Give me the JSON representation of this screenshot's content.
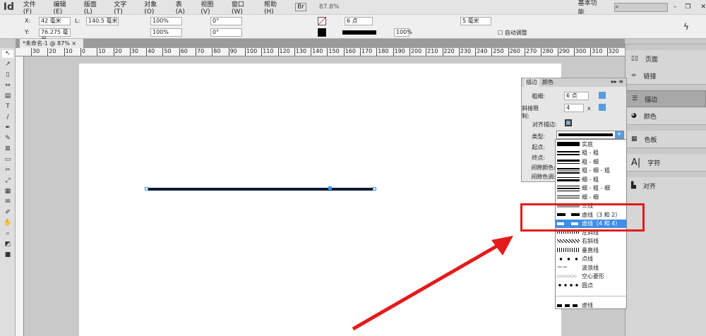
{
  "app": {
    "logo": "Id",
    "zoom": "87.8%",
    "workspace": "基本功能"
  },
  "menu": [
    "文件(F)",
    "编辑(E)",
    "版面(L)",
    "文字(T)",
    "对象(O)",
    "表(A)",
    "视图(V)",
    "窗口(W)",
    "帮助(H)"
  ],
  "control": {
    "x_label": "X:",
    "x": "42 毫米",
    "y_label": "Y:",
    "y": "76.275 毫米",
    "l_label": "L:",
    "l": "140.5 毫米",
    "scale_x": "100%",
    "scale_y": "100%",
    "rot": "0°",
    "shear": "0°",
    "stroke_weight": "6 点",
    "opacity": "100%",
    "offset": "5 毫米",
    "auto_fit": "自动调整"
  },
  "doc_tab": {
    "title": "*未命名-1 @ 87%",
    "close": "×"
  },
  "ruler": [
    "30",
    "20",
    "10",
    "0",
    "10",
    "20",
    "30",
    "40",
    "50",
    "60",
    "70",
    "80",
    "90",
    "100",
    "110",
    "120",
    "130",
    "140",
    "150",
    "160",
    "170",
    "180",
    "190",
    "200",
    "210",
    "220",
    "230",
    "240",
    "250",
    "260",
    "270",
    "280",
    "290",
    "300",
    "310",
    "320"
  ],
  "right_panel": [
    "页面",
    "链接",
    "描边",
    "颜色",
    "色板",
    "字符",
    "对齐"
  ],
  "stroke_panel": {
    "tabs": [
      "描边",
      "颜色"
    ],
    "weight_label": "粗细:",
    "weight": "6 点",
    "miter_label": "斜接限制:",
    "miter": "4",
    "miter_unit": "x",
    "align_label": "对齐描边:",
    "type_label": "类型:",
    "start_label": "起点:",
    "end_label": "终点:",
    "gap_color_label": "间隙颜色:",
    "gap_tint_label": "间隙色调:"
  },
  "type_list": [
    "实底",
    "粗 - 粗",
    "粗 - 细",
    "粗 - 细 - 粗",
    "细 - 粗",
    "细 - 粗 - 细",
    "细 - 细",
    "三线",
    "虚线（3 和 2）",
    "虚线（4 和 4）",
    "左斜线",
    "右斜线",
    "垂直线",
    "点线",
    "波浪线",
    "空心菱形",
    "圆点",
    "虚线"
  ],
  "selected_type": "虚线（4 和 4）",
  "colors": {
    "highlight": "#e31b1b",
    "selection": "#3f8fe6"
  }
}
